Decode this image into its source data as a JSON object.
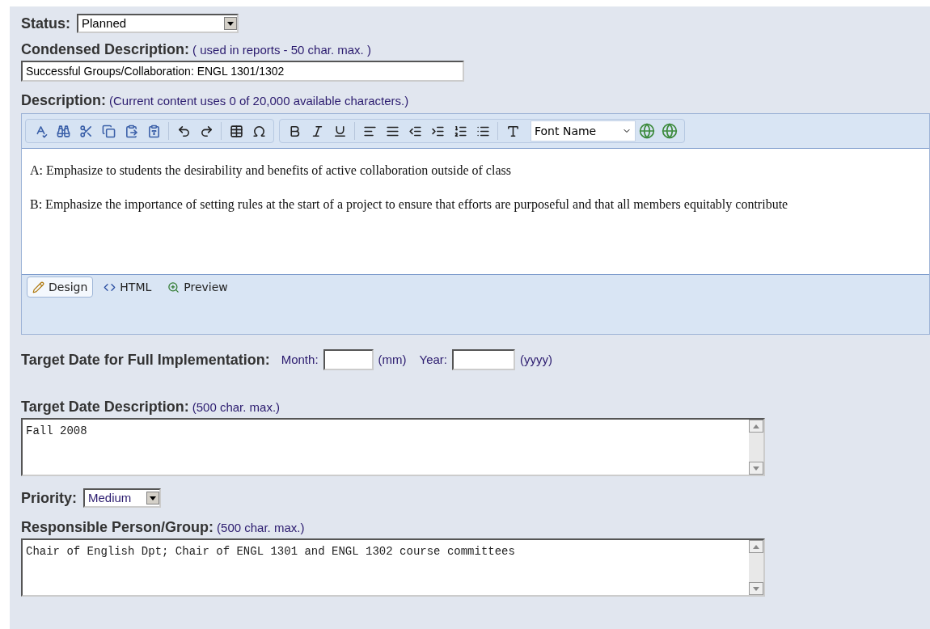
{
  "status": {
    "label": "Status:",
    "value": "Planned"
  },
  "condensed": {
    "label": "Condensed Description:",
    "hint": "( used in reports - 50 char. max. )",
    "value": "Successful Groups/Collaboration: ENGL 1301/1302"
  },
  "description": {
    "label": "Description:",
    "hint": "(Current content uses 0 of 20,000 available characters.)",
    "font_select": "Font Name",
    "paragraphs": [
      "A: Emphasize to students the desirability and benefits of active collaboration outside of class",
      "B: Emphasize the importance of setting rules at the start of a project to ensure that efforts are purposeful and that all members equitably contribute"
    ],
    "modes": [
      {
        "label": "Design",
        "kind": "design",
        "selected": true
      },
      {
        "label": "HTML",
        "kind": "html",
        "selected": false
      },
      {
        "label": "Preview",
        "kind": "preview",
        "selected": false
      }
    ]
  },
  "target_date": {
    "label": "Target Date for Full Implementation:",
    "month_label": "Month:",
    "month_hint": "(mm)",
    "year_label": "Year:",
    "year_hint": "(yyyy)"
  },
  "target_desc": {
    "label": "Target Date Description:",
    "hint": "(500 char. max.)",
    "value": "Fall 2008"
  },
  "priority": {
    "label": "Priority:",
    "value": "Medium"
  },
  "responsible": {
    "label": "Responsible Person/Group:",
    "hint": "(500 char. max.)",
    "value": "Chair of English Dpt; Chair of ENGL 1301 and ENGL 1302 course committees"
  }
}
